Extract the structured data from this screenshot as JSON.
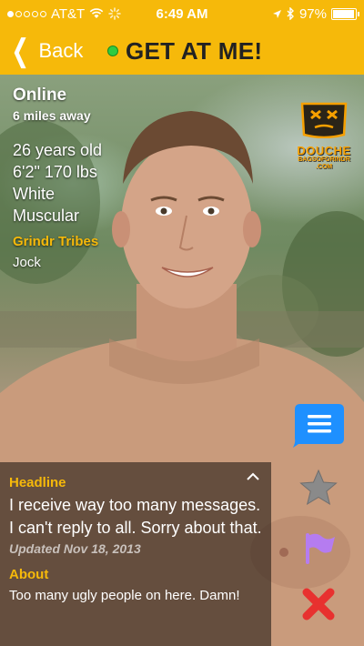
{
  "status_bar": {
    "carrier": "AT&T",
    "time": "6:49 AM",
    "battery": "97%",
    "battery_level": 0.97
  },
  "nav": {
    "back_label": "Back",
    "title": "GET AT ME!"
  },
  "profile": {
    "status": "Online",
    "distance": "6 miles away",
    "age": "26 years old",
    "height_weight": "6'2\" 170 lbs",
    "ethnicity": "White",
    "body_type": "Muscular",
    "tribes_heading": "Grindr Tribes",
    "tribes_value": "Jock"
  },
  "watermark": {
    "line1": "DOUCHE",
    "line2": "BAGSOFGRINDR",
    "line3": ".COM"
  },
  "panel": {
    "headline_heading": "Headline",
    "headline_text": "I receive way too many messages. I can't reply to all. Sorry about that.",
    "updated": "Updated Nov 18, 2013",
    "about_heading": "About",
    "about_text": "Too many ugly people on here. Damn!"
  },
  "colors": {
    "accent": "#f6b90a",
    "online": "#2ecc40",
    "chat": "#1e90ff",
    "favorite": "#8a8a8a",
    "flag": "#b57cf0",
    "block": "#e8312f"
  },
  "icons": [
    "back-chevron-icon",
    "chat-icon",
    "favorite-star-icon",
    "flag-icon",
    "block-x-icon",
    "collapse-chevron-icon",
    "wifi-icon",
    "location-arrow-icon",
    "bluetooth-icon",
    "battery-icon"
  ]
}
